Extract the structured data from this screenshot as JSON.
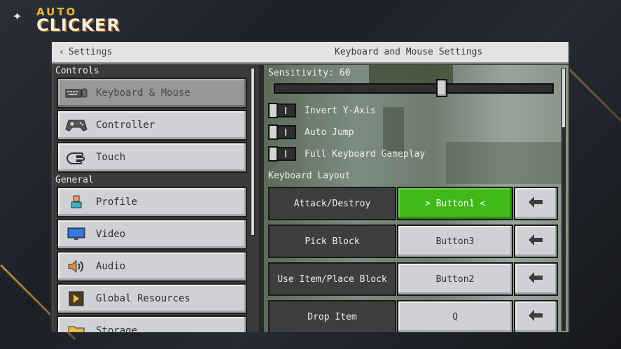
{
  "brand": {
    "line1": "AUTO",
    "line2": "CLICKER"
  },
  "titlebar": {
    "back_label": "Settings",
    "title": "Keyboard and Mouse Settings"
  },
  "nav": {
    "sections": [
      {
        "label": "Controls"
      },
      {
        "label": "General"
      }
    ],
    "items": [
      {
        "label": "Keyboard & Mouse",
        "icon": "keyboard-mouse-icon",
        "active": true
      },
      {
        "label": "Controller",
        "icon": "gamepad-icon"
      },
      {
        "label": "Touch",
        "icon": "touch-hand-icon"
      },
      {
        "label": "Profile",
        "icon": "profile-icon"
      },
      {
        "label": "Video",
        "icon": "monitor-icon"
      },
      {
        "label": "Audio",
        "icon": "speaker-icon"
      },
      {
        "label": "Global Resources",
        "icon": "resource-pack-icon"
      },
      {
        "label": "Storage",
        "icon": "folder-icon"
      }
    ]
  },
  "settings": {
    "sensitivity_label": "Sensitivity: 60",
    "sensitivity_value": 60,
    "toggles": [
      {
        "label": "Invert Y-Axis",
        "on": false
      },
      {
        "label": "Auto Jump",
        "on": false
      },
      {
        "label": "Full Keyboard Gameplay",
        "on": false
      }
    ],
    "keyboard_layout_label": "Keyboard Layout",
    "bindings": [
      {
        "action": "Attack/Destroy",
        "key": "> Button1 <",
        "selected": true
      },
      {
        "action": "Pick Block",
        "key": "Button3"
      },
      {
        "action": "Use Item/Place Block",
        "key": "Button2"
      },
      {
        "action": "Drop Item",
        "key": "Q"
      }
    ]
  },
  "colors": {
    "accent_green": "#3fb818",
    "logo_gold": "#f2b531",
    "panel_gray": "#d0d1d4"
  }
}
